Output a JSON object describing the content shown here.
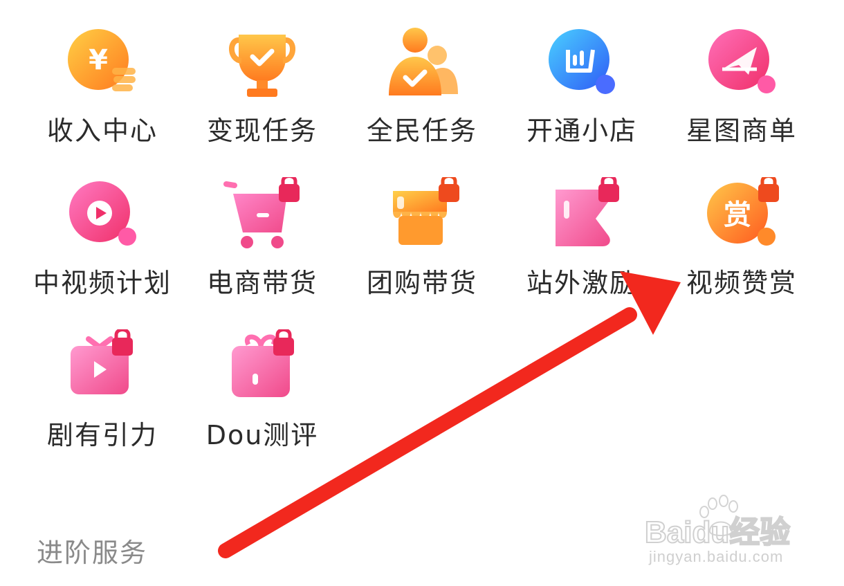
{
  "grid": {
    "rows": [
      [
        {
          "label": "收入中心",
          "icon": "income-coin-icon"
        },
        {
          "label": "变现任务",
          "icon": "trophy-icon"
        },
        {
          "label": "全民任务",
          "icon": "people-check-icon"
        },
        {
          "label": "开通小店",
          "icon": "store-chart-icon"
        },
        {
          "label": "星图商单",
          "icon": "star-map-icon"
        }
      ],
      [
        {
          "label": "中视频计划",
          "icon": "video-play-icon"
        },
        {
          "label": "电商带货",
          "icon": "shopping-cart-locked-icon"
        },
        {
          "label": "团购带货",
          "icon": "shop-awning-locked-icon"
        },
        {
          "label": "站外激励",
          "icon": "flag-locked-icon"
        },
        {
          "label": "视频赞赏",
          "icon": "reward-locked-icon",
          "badge_text": "赏"
        }
      ],
      [
        {
          "label": "剧有引力",
          "icon": "drama-tv-locked-icon"
        },
        {
          "label": "Dou测评",
          "icon": "gift-box-locked-icon"
        }
      ]
    ]
  },
  "section": {
    "title": "进阶服务"
  },
  "watermark": {
    "brand": "Baidu经验",
    "url": "jingyan.baidu.com"
  },
  "colors": {
    "orange": "#ff9a2e",
    "pink": "#ff4f9a",
    "blue": "#2f7cf6",
    "arrow": "#f2281e",
    "lock": "#e8285a"
  }
}
